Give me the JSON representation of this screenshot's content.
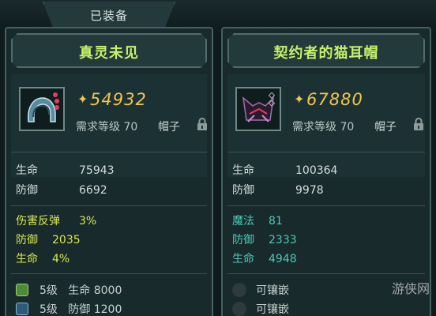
{
  "tab": {
    "label": "已装备"
  },
  "left_item": {
    "name": "真灵未见",
    "icon": "helmet-icon",
    "price": "54932",
    "requirement": "需求等级 70",
    "slot": "帽子",
    "base_stats": [
      {
        "label": "生命",
        "value": "75943"
      },
      {
        "label": "防御",
        "value": "6692"
      }
    ],
    "extra_stats": [
      {
        "label": "伤害反弹",
        "value": "3%"
      },
      {
        "label": "防御",
        "value": "2035"
      },
      {
        "label": "生命",
        "value": "4%"
      }
    ],
    "gems": [
      {
        "level": "5级",
        "effect": "生命 8000",
        "icon": "green-gem-icon"
      },
      {
        "level": "5级",
        "effect": "防御 1200",
        "icon": "blue-gem-icon"
      }
    ]
  },
  "right_item": {
    "name": "契约者的猫耳帽",
    "icon": "cat-ear-hat-icon",
    "price": "67880",
    "requirement": "需求等级 70",
    "slot": "帽子",
    "base_stats": [
      {
        "label": "生命",
        "value": "100364"
      },
      {
        "label": "防御",
        "value": "9978"
      }
    ],
    "extra_stats": [
      {
        "label": "魔法",
        "value": "81"
      },
      {
        "label": "防御",
        "value": "2333"
      },
      {
        "label": "生命",
        "value": "4948"
      }
    ],
    "sockets": [
      {
        "label": "可镶嵌"
      },
      {
        "label": "可镶嵌"
      }
    ]
  },
  "watermark": "游侠网",
  "colors": {
    "title": "#c6f26a",
    "price": "#f0c650",
    "extra_stat": "#d8e84e",
    "base_stat": "#d4dedc"
  }
}
